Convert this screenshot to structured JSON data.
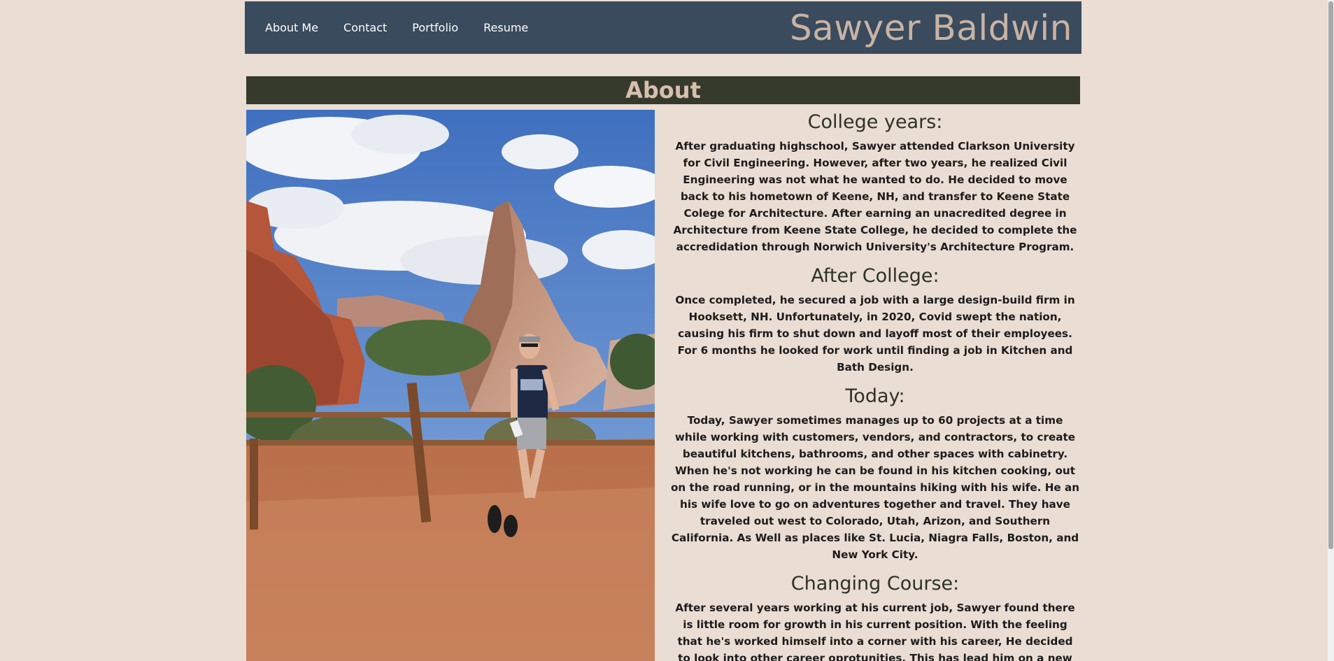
{
  "nav": {
    "links": [
      "About Me",
      "Contact",
      "Portfolio",
      "Resume"
    ],
    "site_title": "Sawyer Baldwin"
  },
  "section": {
    "title": "About"
  },
  "photo": {
    "icon": "person-hiking-photo",
    "alt": ""
  },
  "content": [
    {
      "heading": "College years:",
      "body": "After graduating highschool, Sawyer attended Clarkson University for Civil Engineering. However, after two years, he realized Civil Engineering was not what he wanted to do. He decided to move back to his hometown of Keene, NH, and transfer to Keene State Colege for Architecture. After earning an unacredited degree in Architecture from Keene State College, he decided to complete the accredidation through Norwich University's Architecture Program."
    },
    {
      "heading": "After College:",
      "body": "Once completed, he secured a job with a large design-build firm in Hooksett, NH. Unfortunately, in 2020, Covid swept the nation, causing his firm to shut down and layoff most of their employees. For 6 months he looked for work until finding a job in Kitchen and Bath Design."
    },
    {
      "heading": "Today:",
      "body": "Today, Sawyer sometimes manages up to 60 projects at a time while working with customers, vendors, and contractors, to create beautiful kitchens, bathrooms, and other spaces with cabinetry. When he's not working he can be found in his kitchen cooking, out on the road running, or in the mountains hiking with his wife. He an his wife love to go on adventures together and travel. They have traveled out west to Colorado, Utah, Arizon, and Southern California. As Well as places like St. Lucia, Niagra Falls, Boston, and New York City."
    },
    {
      "heading": "Changing Course:",
      "body": "After several years working at his current job, Sawyer found there is little room for growth in his current position. With the feeling that he's worked himself into a corner with his career, He decided to look into other career oprotunities. This has lead him on a new journey with coding and software development."
    }
  ],
  "colors": {
    "background": "#eaddd3",
    "navbar": "#3a4b5e",
    "section_bar": "#363a2c",
    "title_text": "#c9b3a4"
  }
}
